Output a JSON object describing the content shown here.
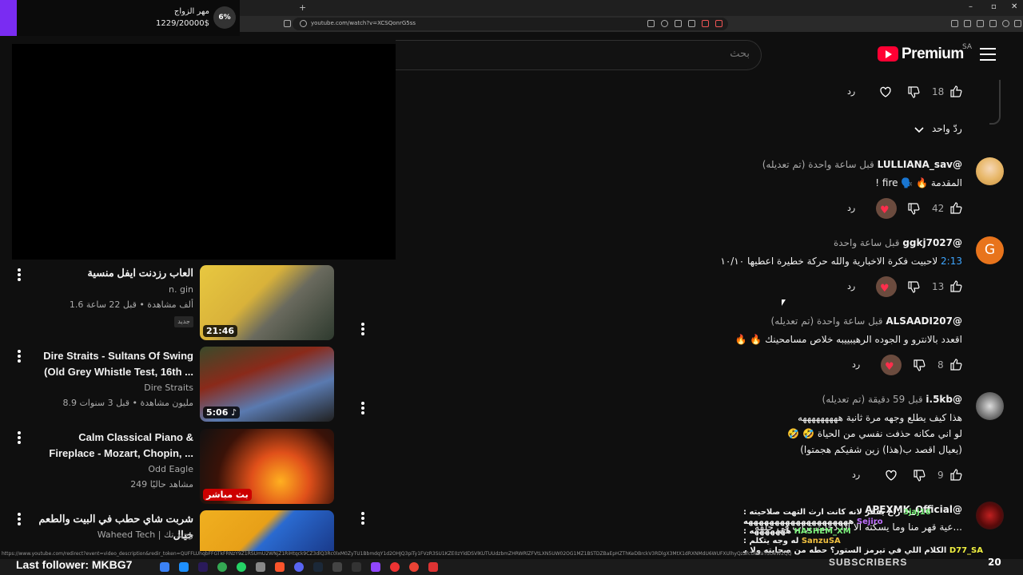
{
  "browser": {
    "url": "youtube.com/watch?v=XCSQonrG5ss",
    "new_tab": "+",
    "window_controls": [
      "–",
      "▫",
      "✕"
    ]
  },
  "goal_overlay": {
    "title": "مهر الزواج",
    "amount": "1229/20000$",
    "percent": "6%",
    "progress": 0.06
  },
  "header": {
    "logo_text": "Premium",
    "country": "SA",
    "search_placeholder": "بحث"
  },
  "recommendations": [
    {
      "title": "العاب رزدنت ايفل منسية",
      "channel": "n. gin",
      "meta": "1.6 ألف مشاهدة • قبل 22 ساعة",
      "duration": "21:46",
      "badge": "جديد",
      "thumb": "a"
    },
    {
      "title": "Dire Straits - Sultans Of Swing (Old Grey Whistle Test, 16th ...",
      "channel": "Dire Straits",
      "meta": "8.9 مليون مشاهدة • قبل 3 سنوات",
      "duration": "5:06 ♪",
      "badge": "",
      "thumb": "b"
    },
    {
      "title": "Calm Classical Piano & Fireplace - Mozart, Chopin, ...",
      "channel": "Odd Eagle",
      "meta": "249 مشاهد حاليًا",
      "duration": "بث مباشر",
      "badge": "",
      "thumb": "c"
    },
    {
      "title": "شربت شاي حطب في البيت والطعم خيال",
      "channel": "Waheed Tech | وحيد تك",
      "meta": "",
      "duration": "",
      "badge": "",
      "thumb": "d"
    }
  ],
  "thread_prev": {
    "likes": "18",
    "reply": "رد",
    "replies_toggle": "ردّ واحد"
  },
  "comments": [
    {
      "author": "@LULLIANA_sav",
      "time": "قبل ساعة واحدة (تم تعديله)",
      "lines": [
        "المقدمة 🔥 🗣️ fire !"
      ],
      "likes": "42",
      "reply": "رد"
    },
    {
      "author": "@ggkj7027",
      "time": "قبل ساعة واحدة",
      "timestamp": "2:13",
      "lines": [
        "لاحبيت فكرة الاخبارية والله حركة خطيرة اعطيها ١٠/١٠"
      ],
      "likes": "13",
      "reply": "رد"
    },
    {
      "author": "@ALSAADI207",
      "time": "قبل ساعة واحدة (تم تعديله)",
      "lines": [
        "اقعدد بالانترو و الجوده الرهيبييبه خلاص مسامحينك 🔥 🔥"
      ],
      "likes": "8",
      "reply": "رد"
    },
    {
      "author": "@i.5kb",
      "time": "قبل 59 دقيقة (تم تعديله)",
      "lines": [
        "هذا كيف يطلع وجهه مرة ثانية هههههههههه",
        "لو اني مكانه حذفت نفسي من الحياة 🤣 🤣",
        "(يعيال اقصد ب(هذا) زين شفيكم هجمتوا)"
      ],
      "likes": "9",
      "reply": "رد"
    },
    {
      "author": "@APEXMK_Official",
      "time": "",
      "lines": [
        "...عية قهر منا وما يسكته الا اذا دخلت تراب في حلقه"
      ],
      "likes": "",
      "reply": ""
    }
  ],
  "chat_overlay": [
    {
      "user": "3jaj16",
      "text": "راح يفقر لانه كانت ارث التهت صلاحيته :"
    },
    {
      "user": "Sejiro",
      "text": "ههههههههههههههههههههه"
    },
    {
      "user": "HASHEM_XM",
      "text": "هههههههه :"
    },
    {
      "user": "SanzuSA",
      "text": "له وجه يتكلم :"
    },
    {
      "user": "D77_SA",
      "text": "الكلام اللي في تيرمز الستور؟ حطه من صحابته ولا يوتيوبرز معه؟ :"
    }
  ],
  "status_url": "https://www.youtube.com/redirect?event=video_description&redir_token=QUFFLUhqbFFGTkFRNzY9Z1RSUmU2WNjZ1RiHtqck9CZ3dlQ3Rc0lxM0ZyTU1BbmdqY1d2OHJQ3piTy1FVzR3SU1KZE0zYldDSVlKUTUUdzbmZHRWRlZFVtLXN5UW02OG1MZ1BSTDZBaEpHZThKeDBrckV3RDlgX3MtX1dRXNMdU6WUFXUlhyQzZfcUhZaTdOeW2QQ",
  "taskbar": {
    "last_follower": "Last follower: MKBG7",
    "subscribers_label": "SUBSCRIBERS",
    "subscribers_count": "20"
  }
}
